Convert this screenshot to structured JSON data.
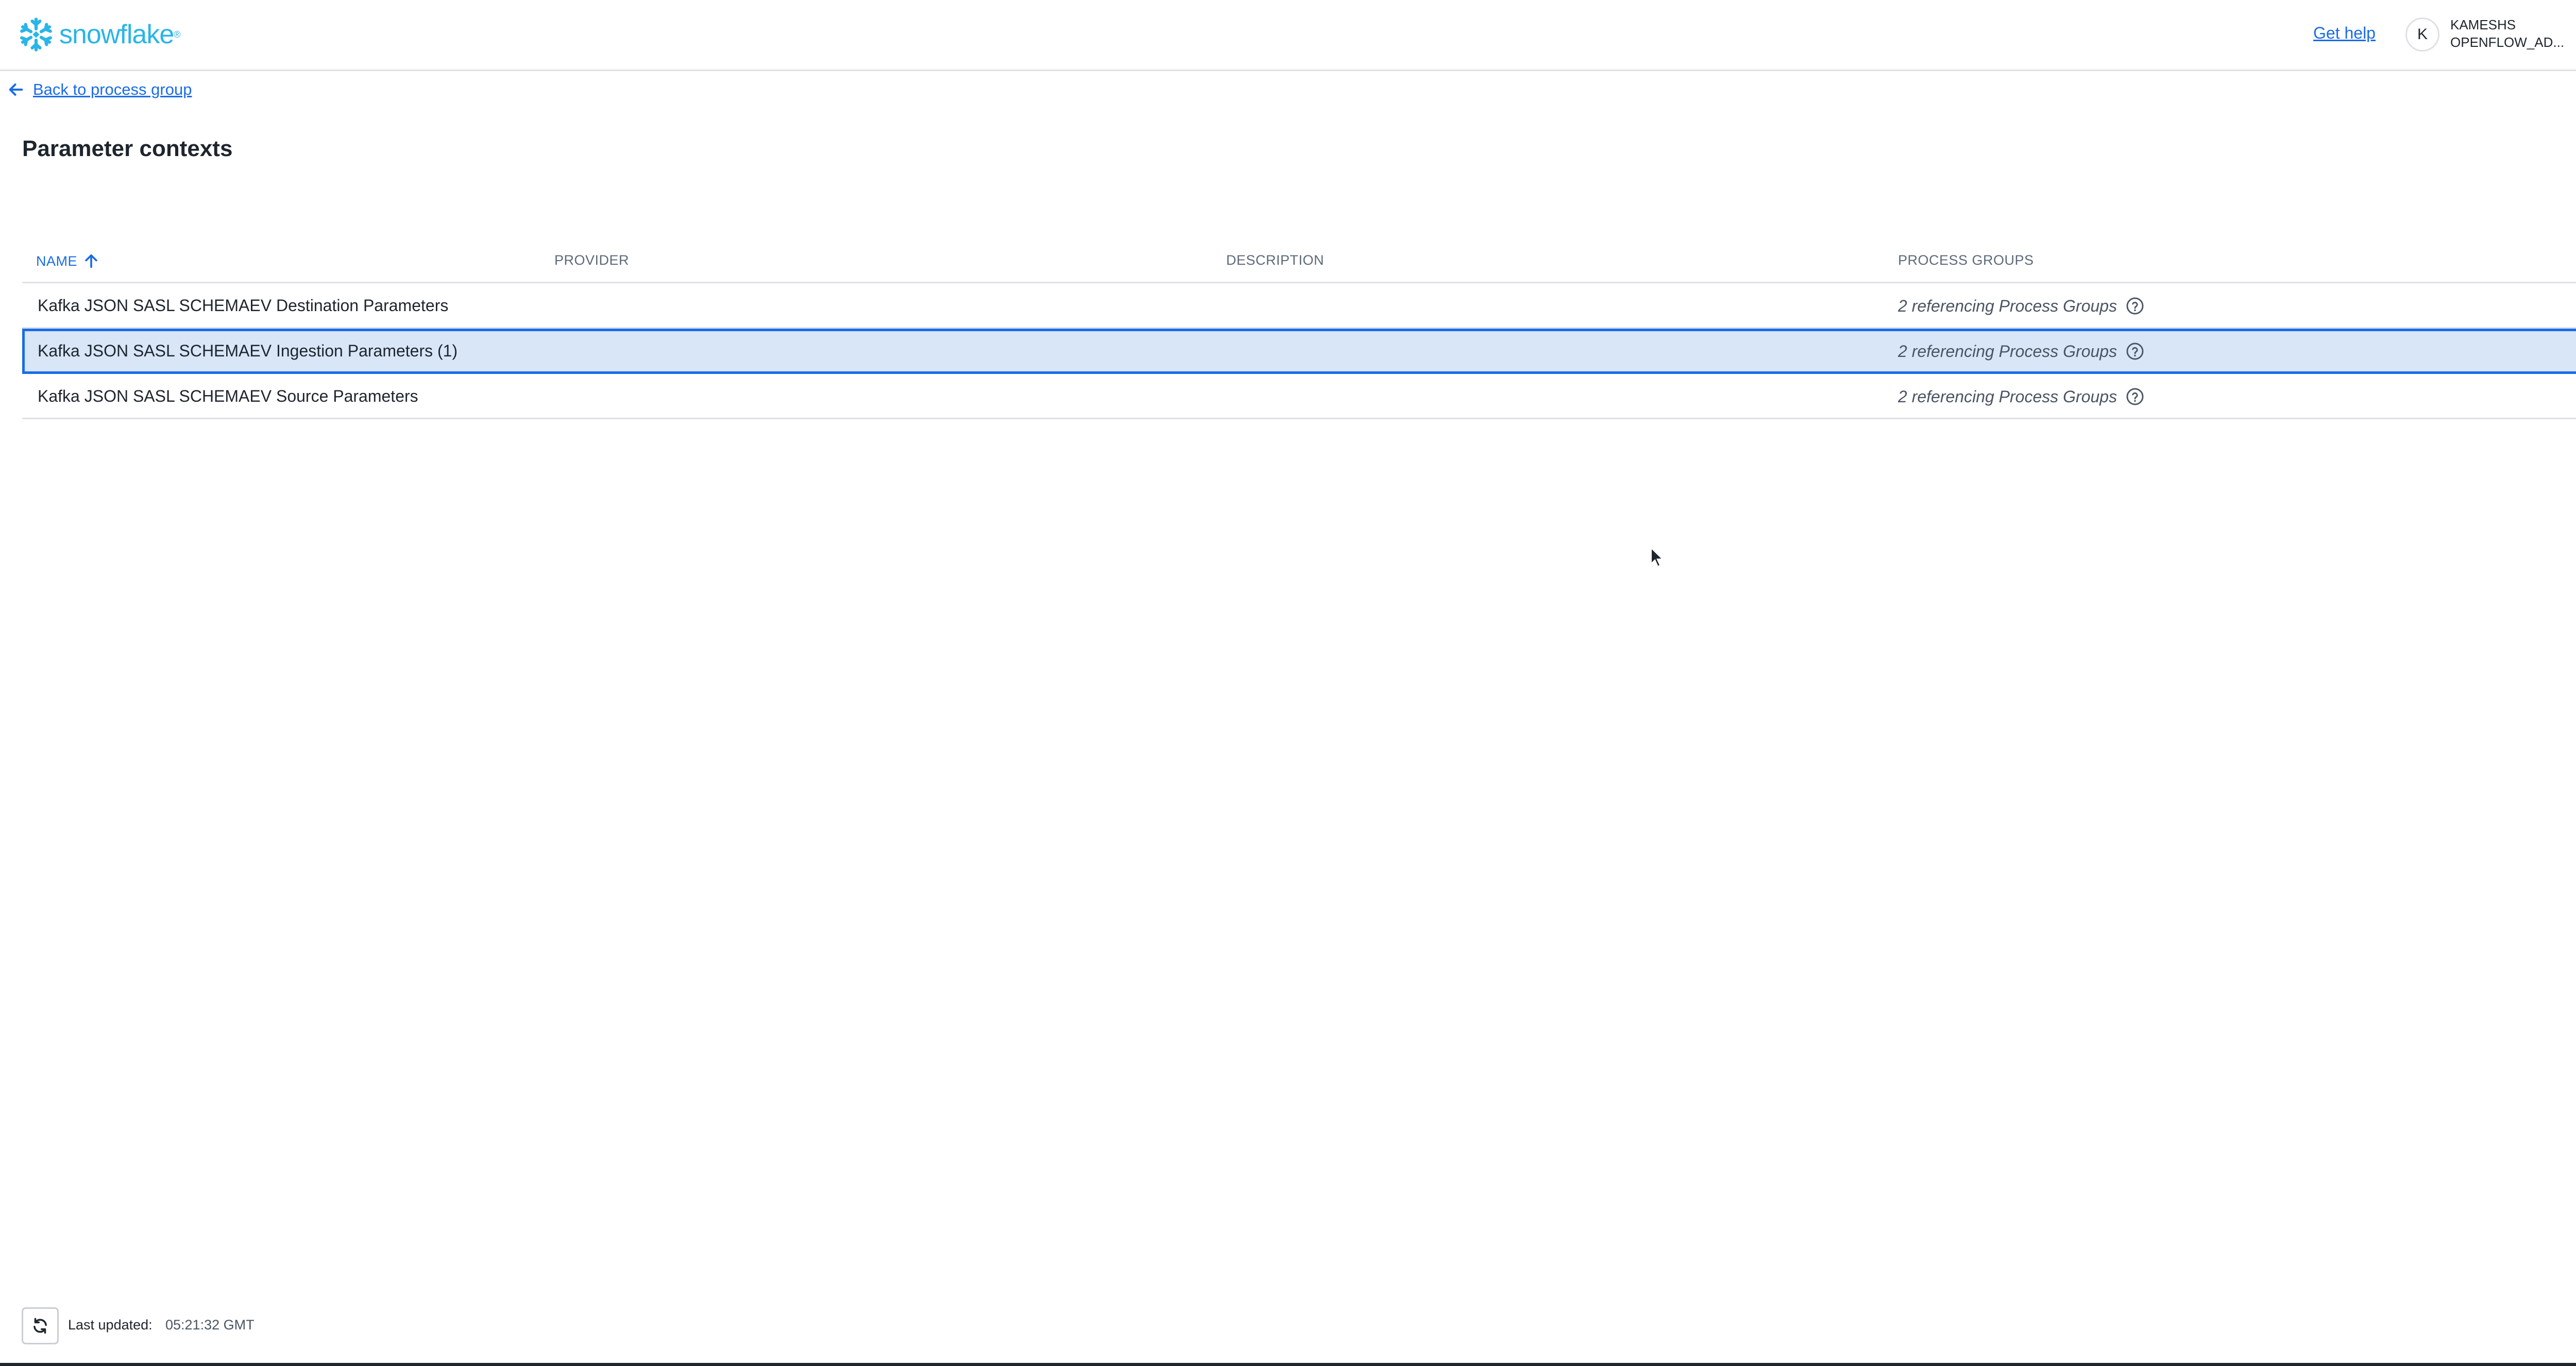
{
  "header": {
    "brand": "snowflake",
    "get_help": "Get help",
    "avatar_initial": "K",
    "user_name": "KAMESHS",
    "user_role": "OPENFLOW_AD..."
  },
  "nav": {
    "back_label": "Back to process group"
  },
  "page": {
    "title": "Parameter contexts"
  },
  "table": {
    "columns": {
      "name": "NAME",
      "provider": "PROVIDER",
      "description": "DESCRIPTION",
      "process_groups": "PROCESS GROUPS"
    },
    "sort": {
      "column": "NAME",
      "direction": "ascending"
    },
    "rows": [
      {
        "name": "Kafka JSON SASL SCHEMAEV Destination Parameters",
        "provider": "",
        "description": "",
        "process_groups": "2 referencing Process Groups",
        "selected": false
      },
      {
        "name": "Kafka JSON SASL SCHEMAEV Ingestion Parameters (1)",
        "provider": "",
        "description": "",
        "process_groups": "2 referencing Process Groups",
        "selected": true
      },
      {
        "name": "Kafka JSON SASL SCHEMAEV Source Parameters",
        "provider": "",
        "description": "",
        "process_groups": "2 referencing Process Groups",
        "selected": false
      }
    ]
  },
  "footer": {
    "last_updated_label": "Last updated:",
    "last_updated_value": "05:21:32 GMT"
  },
  "icons": {
    "logo": "snowflake-logo-icon",
    "back": "arrow-left-icon",
    "sort": "arrow-up-icon",
    "help": "question-circle-icon",
    "row_menu": "kebab-menu-icon",
    "add": "plus-icon",
    "refresh": "refresh-icon",
    "user_menu": "chevron-down-icon"
  },
  "colors": {
    "brand": "#29b5e8",
    "link": "#1a6ce7",
    "selected_row_bg": "#d8e6f8",
    "selected_row_border": "#1a6ce7"
  }
}
